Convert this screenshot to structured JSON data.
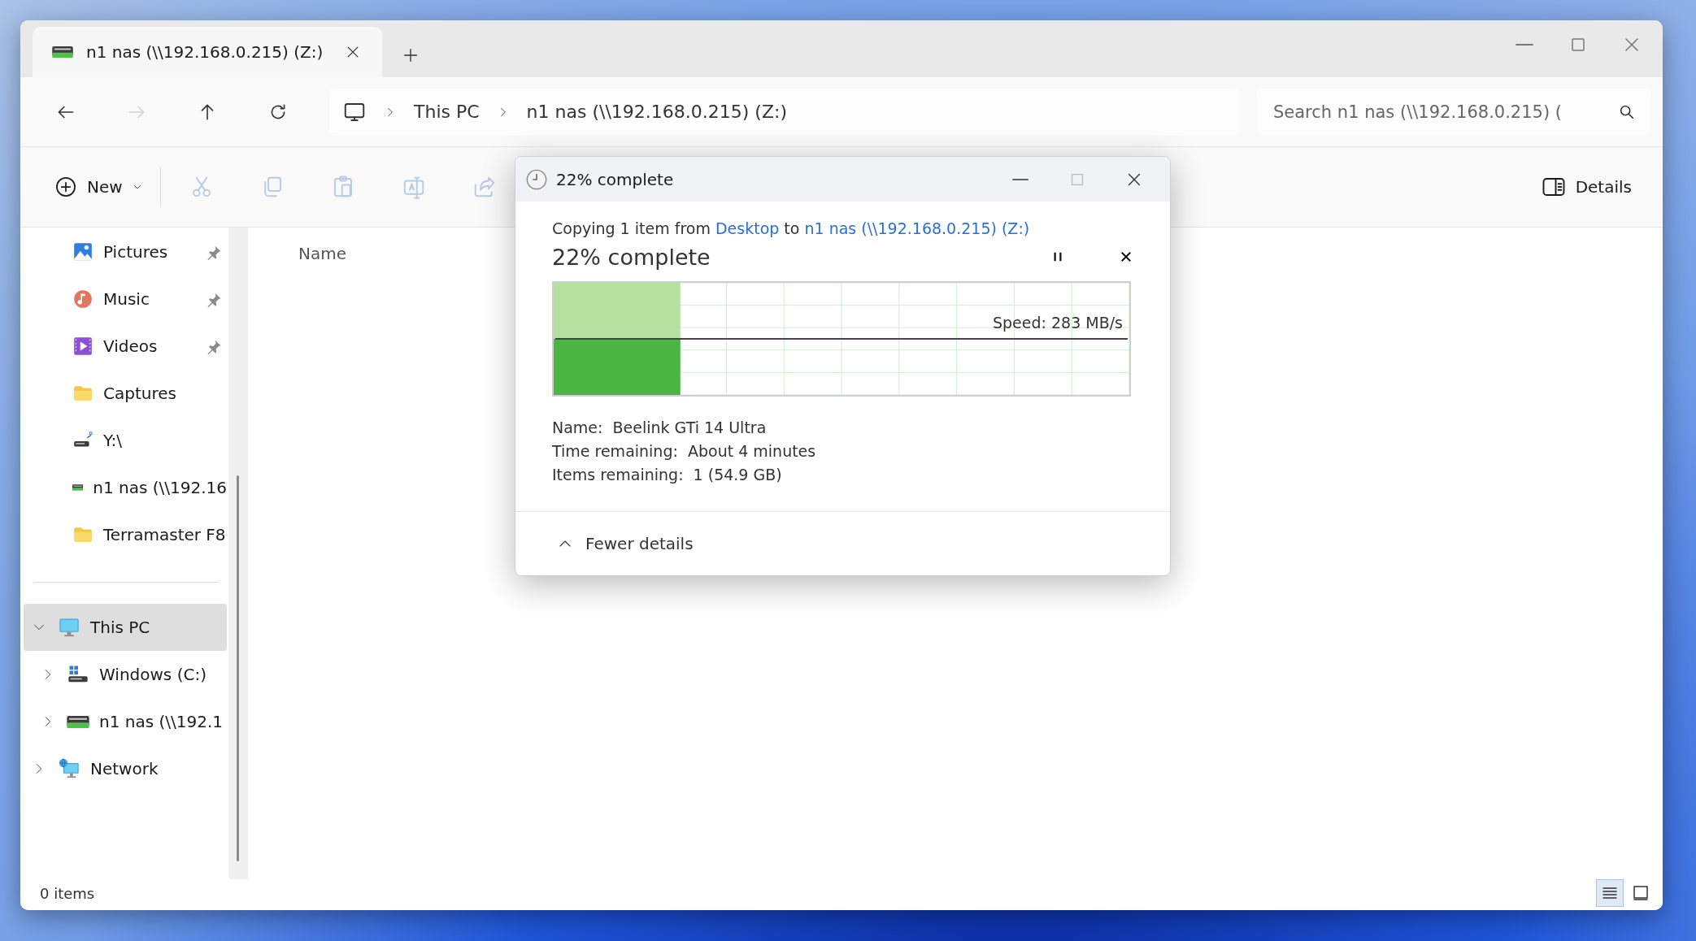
{
  "tab": {
    "title": "n1 nas (\\\\192.168.0.215) (Z:)"
  },
  "nav_buttons": [
    {
      "kind": "back",
      "disabled": false
    },
    {
      "kind": "forward",
      "disabled": true
    },
    {
      "kind": "up",
      "disabled": false
    },
    {
      "kind": "refresh",
      "disabled": false
    }
  ],
  "address": {
    "crumbs": [
      "This PC",
      "n1 nas (\\\\192.168.0.215) (Z:)"
    ]
  },
  "search": {
    "placeholder": "Search n1 nas (\\\\192.168.0.215) ("
  },
  "toolbar": {
    "new_label": "New",
    "tools": [
      {
        "kind": "cut",
        "disabled": true
      },
      {
        "kind": "copy",
        "disabled": true
      },
      {
        "kind": "paste",
        "disabled": true
      },
      {
        "kind": "rename",
        "disabled": true
      },
      {
        "kind": "share",
        "disabled": true
      }
    ],
    "details_label": "Details"
  },
  "sidebar": {
    "quick_access": [
      {
        "label": "Pictures",
        "kind": "pictures",
        "pinned": true
      },
      {
        "label": "Music",
        "kind": "music",
        "pinned": true
      },
      {
        "label": "Videos",
        "kind": "videos",
        "pinned": true
      },
      {
        "label": "Captures",
        "kind": "folder",
        "pinned": false
      },
      {
        "label": "Y:\\",
        "kind": "drive",
        "pinned": false
      },
      {
        "label": "n1 nas (\\\\192.16",
        "kind": "netdrive",
        "pinned": false
      },
      {
        "label": "Terramaster F8",
        "kind": "folder",
        "pinned": false
      }
    ],
    "tree": [
      {
        "label": "This PC",
        "kind": "pc",
        "selected": true,
        "expanded": true,
        "children": [
          {
            "label": "Windows (C:)",
            "kind": "sysdrive",
            "selected": false,
            "expanded": false
          },
          {
            "label": "n1 nas (\\\\192.1",
            "kind": "netdrive",
            "selected": false,
            "expanded": false
          }
        ]
      },
      {
        "label": "Network",
        "kind": "network",
        "selected": false,
        "expanded": false
      }
    ]
  },
  "columns": [
    {
      "label": "Name"
    }
  ],
  "status_bar": {
    "count": "0 items",
    "views": [
      {
        "kind": "details",
        "selected": true
      },
      {
        "kind": "tiles",
        "selected": false
      }
    ]
  },
  "dialog": {
    "title": "22% complete",
    "summary": {
      "prefix": "Copying 1 item from",
      "source": "Desktop",
      "joiner": "to",
      "destination": "n1 nas (\\\\192.168.0.215) (Z:)"
    },
    "heading": "22% complete",
    "level": 0.22,
    "paused": false,
    "speed": "Speed: 283 MB/s",
    "details": [
      {
        "label": "Name:",
        "value": "Beelink GTi 14 Ultra"
      },
      {
        "label": "Time remaining:",
        "value": "About 4 minutes"
      },
      {
        "label": "Items remaining:",
        "value": "1 (54.9 GB)"
      }
    ],
    "toggle": {
      "label": "Fewer details",
      "expanded": true
    },
    "max_disabled": true
  }
}
